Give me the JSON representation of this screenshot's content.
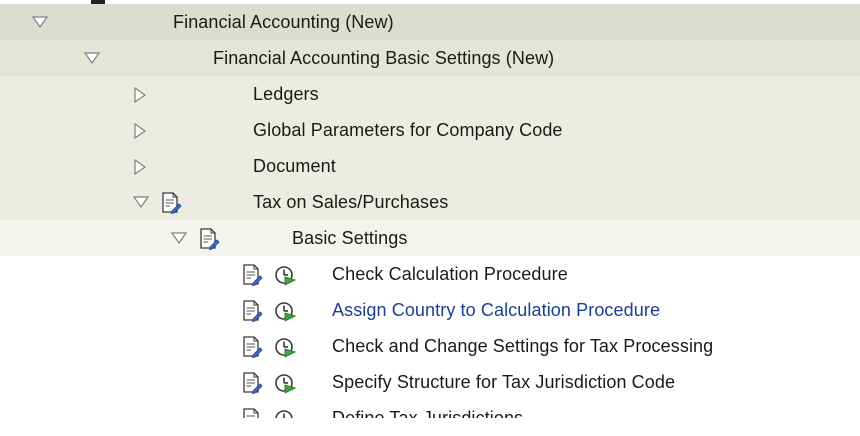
{
  "colors": {
    "level0_bg": "#dcdcd0",
    "level1_bg": "#e4e4d8",
    "level2_bg": "#ecece3",
    "level3_bg": "#f4f4ee",
    "link": "#1a3f9a",
    "text": "#1a1a1a"
  },
  "tree": {
    "financial_accounting": {
      "label": "Financial Accounting (New)",
      "state": "expanded",
      "icon": "triangle-down-icon"
    },
    "basic_settings_new": {
      "label": "Financial Accounting Basic Settings (New)",
      "state": "expanded",
      "icon": "triangle-down-icon"
    },
    "ledgers": {
      "label": "Ledgers",
      "state": "collapsed",
      "icon": "triangle-right-icon"
    },
    "global_parameters": {
      "label": "Global Parameters for Company Code",
      "state": "collapsed",
      "icon": "triangle-right-icon"
    },
    "document": {
      "label": "Document",
      "state": "collapsed",
      "icon": "triangle-right-icon"
    },
    "tax_sales_purchases": {
      "label": "Tax on Sales/Purchases",
      "state": "expanded",
      "icon": "document-icon"
    },
    "basic_settings": {
      "label": "Basic Settings",
      "state": "expanded",
      "icon": "document-icon"
    },
    "activities": [
      {
        "label": "Check Calculation Procedure",
        "icons": [
          "document-icon",
          "execute-clock-icon"
        ],
        "highlighted": false
      },
      {
        "label": "Assign Country to Calculation Procedure",
        "icons": [
          "document-icon",
          "execute-clock-icon"
        ],
        "highlighted": true
      },
      {
        "label": "Check and Change Settings for Tax Processing",
        "icons": [
          "document-icon",
          "execute-clock-icon"
        ],
        "highlighted": false
      },
      {
        "label": "Specify Structure for Tax Jurisdiction Code",
        "icons": [
          "document-icon",
          "execute-clock-icon"
        ],
        "highlighted": false
      },
      {
        "label": "Define Tax Jurisdictions",
        "icons": [
          "document-icon",
          "execute-clock-icon"
        ],
        "highlighted": false
      }
    ]
  }
}
